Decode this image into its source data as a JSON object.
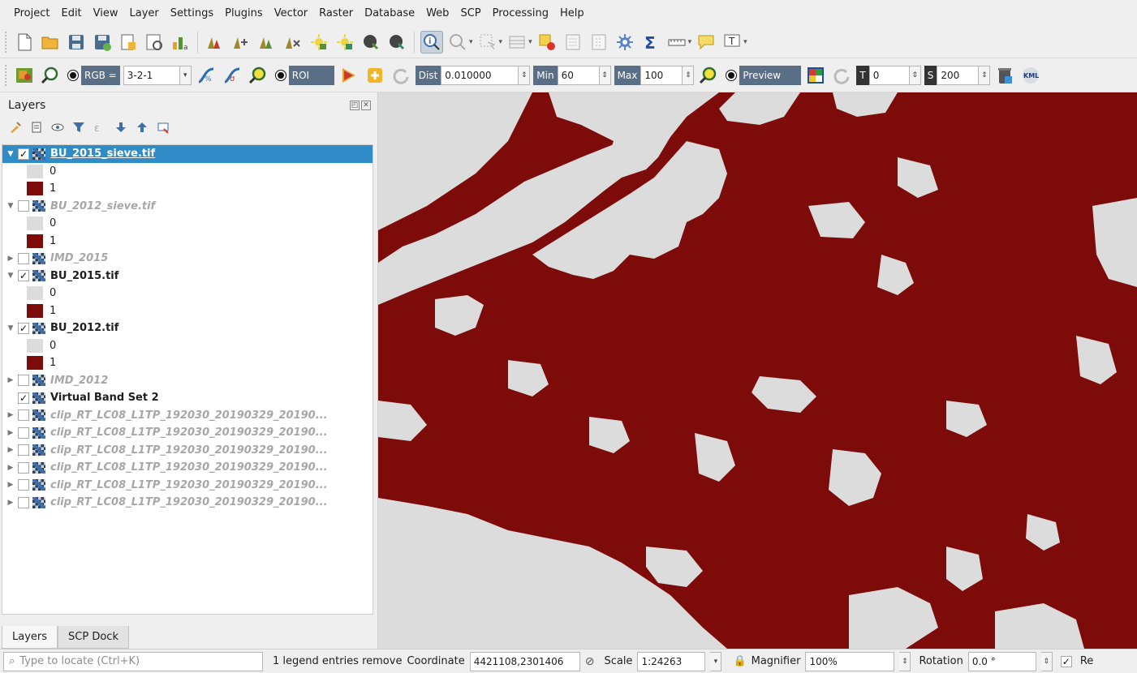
{
  "menu": [
    "Project",
    "Edit",
    "View",
    "Layer",
    "Settings",
    "Plugins",
    "Vector",
    "Raster",
    "Database",
    "Web",
    "SCP",
    "Processing",
    "Help"
  ],
  "scp_toolbar": {
    "rgb_label": "RGB =",
    "rgb_value": "3-2-1",
    "roi_label": "ROI",
    "dist_label": "Dist",
    "dist_value": "0.010000",
    "min_label": "Min",
    "min_value": "60",
    "max_label": "Max",
    "max_value": "100",
    "preview_label": "Preview",
    "t_label": "T",
    "t_value": "0",
    "s_label": "S",
    "s_value": "200",
    "kml_label": "KML"
  },
  "layers_panel": {
    "title": "Layers",
    "tabs": [
      "Layers",
      "SCP Dock"
    ]
  },
  "layers": [
    {
      "name": "BU_2015_sieve.tif",
      "checked": "✓",
      "expanded": true,
      "style": "selected",
      "legend": [
        "0",
        "1"
      ]
    },
    {
      "name": "BU_2012_sieve.tif",
      "checked": "",
      "expanded": true,
      "style": "gray",
      "legend": [
        "0",
        "1"
      ]
    },
    {
      "name": "IMD_2015",
      "checked": "",
      "expanded": false,
      "style": "gray",
      "legend": []
    },
    {
      "name": "BU_2015.tif",
      "checked": "✓",
      "expanded": true,
      "style": "bold",
      "legend": [
        "0",
        "1"
      ]
    },
    {
      "name": "BU_2012.tif",
      "checked": "✓",
      "expanded": true,
      "style": "bold",
      "legend": [
        "0",
        "1"
      ]
    },
    {
      "name": "IMD_2012",
      "checked": "",
      "expanded": false,
      "style": "gray",
      "legend": []
    },
    {
      "name": "Virtual Band Set 2",
      "checked": "✓",
      "expanded": null,
      "style": "bold",
      "legend": []
    },
    {
      "name": "clip_RT_LC08_L1TP_192030_20190329_20190...",
      "checked": "",
      "expanded": false,
      "style": "gray",
      "legend": []
    },
    {
      "name": "clip_RT_LC08_L1TP_192030_20190329_20190...",
      "checked": "",
      "expanded": false,
      "style": "gray",
      "legend": []
    },
    {
      "name": "clip_RT_LC08_L1TP_192030_20190329_20190...",
      "checked": "",
      "expanded": false,
      "style": "gray",
      "legend": []
    },
    {
      "name": "clip_RT_LC08_L1TP_192030_20190329_20190...",
      "checked": "",
      "expanded": false,
      "style": "gray",
      "legend": []
    },
    {
      "name": "clip_RT_LC08_L1TP_192030_20190329_20190...",
      "checked": "",
      "expanded": false,
      "style": "gray",
      "legend": []
    },
    {
      "name": "clip_RT_LC08_L1TP_192030_20190329_20190...",
      "checked": "",
      "expanded": false,
      "style": "gray",
      "legend": []
    }
  ],
  "colors": {
    "value_0": "#dcdcdc",
    "value_1": "#7c0b0a",
    "selection": "#308cc6"
  },
  "status": {
    "locate_placeholder": "Type to locate (Ctrl+K)",
    "message": "1 legend entries remove",
    "coordinate_label": "Coordinate",
    "coordinate_value": "4421108,2301406",
    "scale_label": "Scale",
    "scale_value": "1:24263",
    "magnifier_label": "Magnifier",
    "magnifier_value": "100%",
    "rotation_label": "Rotation",
    "rotation_value": "0.0 °",
    "render_label": "Re"
  }
}
